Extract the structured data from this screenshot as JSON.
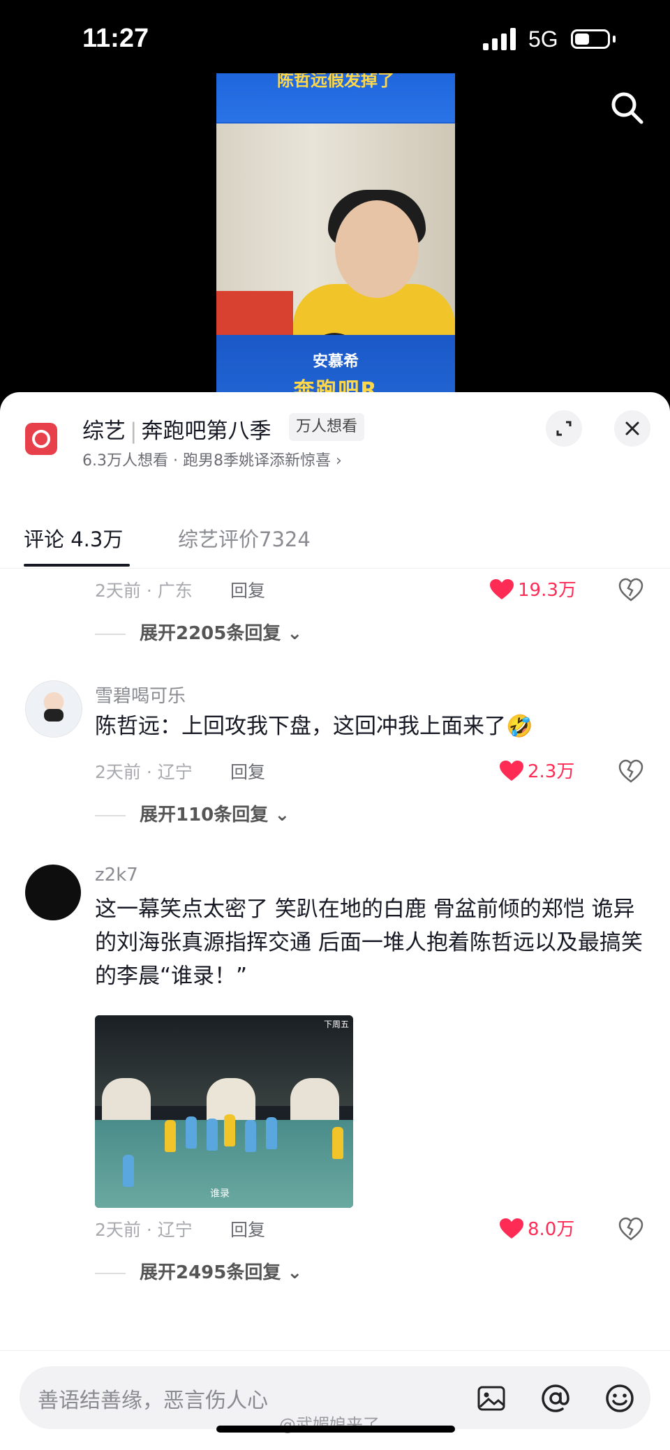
{
  "status_bar": {
    "time": "11:27",
    "network": "5G"
  },
  "video": {
    "caption": "陈哲远假发掉了",
    "brand": "安慕希",
    "logo": "奔跑吧R"
  },
  "header": {
    "category": "综艺",
    "show_name": "奔跑吧第八季",
    "want_tag": "万人想看",
    "subtitle": "6.3万人想看 · 跑男8季姚译添新惊喜 ›"
  },
  "tabs": [
    {
      "label": "评论 4.3万",
      "active": true
    },
    {
      "label": "综艺评价7324",
      "active": false
    }
  ],
  "comments": [
    {
      "meta": "2天前 · 广东",
      "reply": "回复",
      "likes": "19.3万",
      "expand": "展开2205条回复 ⌄"
    },
    {
      "user": "雪碧喝可乐",
      "text": "陈哲远：上回攻我下盘，这回冲我上面来了🤣",
      "meta": "2天前 · 辽宁",
      "reply": "回复",
      "likes": "2.3万",
      "expand": "展开110条回复 ⌄"
    },
    {
      "user": "z2k7",
      "text": "这一幕笑点太密了 笑趴在地的白鹿 骨盆前倾的郑恺 诡异的刘海张真源指挥交通 后面一堆人抱着陈哲远以及最搞笑的李晨“谁录！”",
      "image_label_top": "下周五",
      "image_caption": "谁录",
      "meta": "2天前 · 辽宁",
      "reply": "回复",
      "likes": "8.0万",
      "expand": "展开2495条回复 ⌄"
    }
  ],
  "input": {
    "placeholder": "善语结善缘，恶言伤人心"
  },
  "watermark": "@武媚娘来了",
  "colors": {
    "accent": "#fe2c55",
    "sheet": "#ffffff",
    "text": "#161823"
  }
}
